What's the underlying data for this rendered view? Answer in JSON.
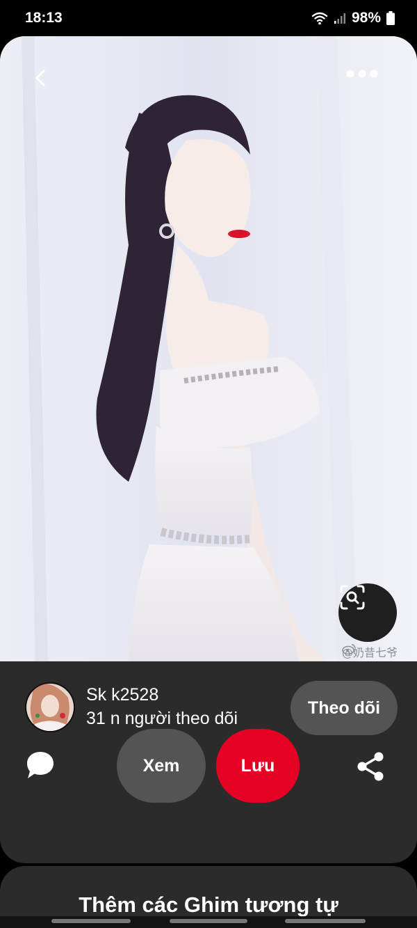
{
  "status_bar": {
    "time": "18:13",
    "battery": "98%",
    "icons": [
      "wifi-icon",
      "signal-icon",
      "battery-icon"
    ]
  },
  "pin": {
    "watermark": "@奶昔七爷",
    "watermark_icon": "weibo-icon",
    "top_icons": [
      "back-chevron-icon",
      "more-dots-icon"
    ],
    "visual_search_icon": "lens-scan-icon"
  },
  "creator": {
    "name": "Sk k2528",
    "followers": "31 n người theo dõi",
    "follow_label": "Theo dõi"
  },
  "actions": {
    "view_label": "Xem",
    "save_label": "Lưu",
    "comment_icon": "comment-bubble-icon",
    "share_icon": "share-icon"
  },
  "more_section": {
    "title": "Thêm các Ghim tương tự"
  },
  "colors": {
    "save_red": "#e60023",
    "pill_gray": "#545454",
    "card_bg": "#2b2b2b",
    "lens_bg": "#1f1f1f"
  }
}
